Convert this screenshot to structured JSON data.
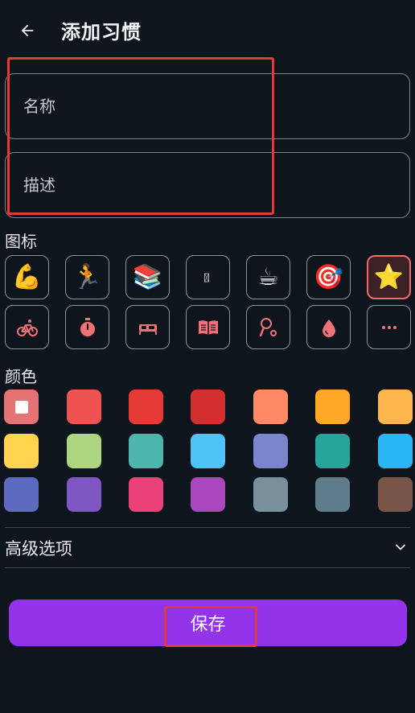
{
  "header": {
    "title": "添加习惯",
    "back_icon": "arrow-left-icon"
  },
  "form": {
    "name_placeholder": "名称",
    "description_placeholder": "描述"
  },
  "icons_section": {
    "label": "图标",
    "icons": [
      {
        "name": "flexed-biceps-icon",
        "glyph": "💪"
      },
      {
        "name": "running-person-icon",
        "glyph": "🏃"
      },
      {
        "name": "books-icon",
        "glyph": "📚"
      },
      {
        "name": "unknown-icon",
        "glyph": "▯"
      },
      {
        "name": "hot-beverage-icon",
        "glyph": "☕"
      },
      {
        "name": "direct-hit-icon",
        "glyph": "🎯"
      },
      {
        "name": "star-icon",
        "glyph": "⭐",
        "selected": true
      },
      {
        "name": "bicycle-icon"
      },
      {
        "name": "timer-icon"
      },
      {
        "name": "bed-icon"
      },
      {
        "name": "open-book-icon"
      },
      {
        "name": "jump-rope-icon"
      },
      {
        "name": "water-drop-icon"
      },
      {
        "name": "more-icon"
      }
    ]
  },
  "colors_section": {
    "label": "颜色",
    "colors": [
      "#e57373",
      "#ef5350",
      "#e53935",
      "#d32f2f",
      "#ff8a65",
      "#ffa726",
      "#ffb74d",
      "#ffd54f",
      "#aed581",
      "#4db6ac",
      "#4fc3f7",
      "#7986cb",
      "#26a69a",
      "#29b6f6",
      "#5c6bc0",
      "#7e57c2",
      "#ec407a",
      "#ab47bc",
      "#78909c",
      "#607d8b",
      "#795548"
    ],
    "selected_index": 0
  },
  "advanced": {
    "label": "高级选项",
    "icon": "chevron-down-icon"
  },
  "save_button": {
    "label": "保存"
  },
  "accent_color": "#9333ea",
  "highlight_color": "#e53935"
}
